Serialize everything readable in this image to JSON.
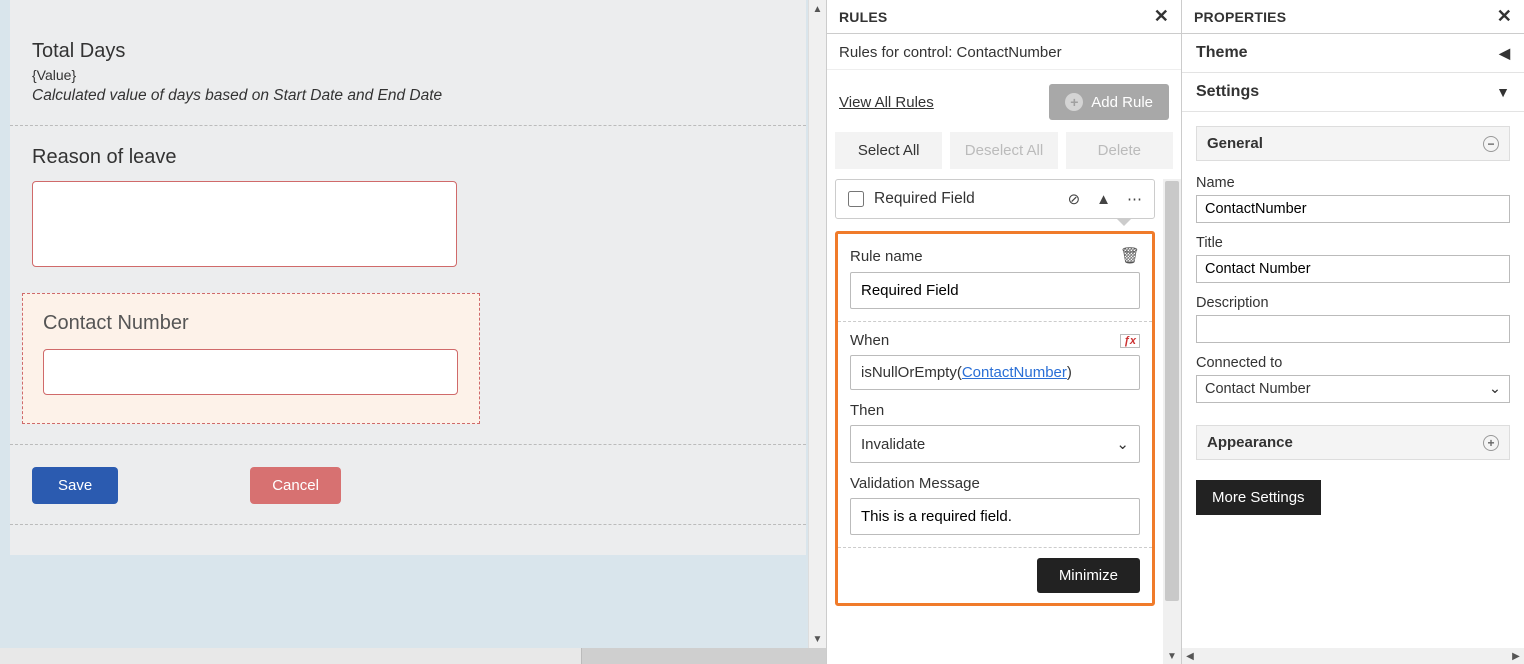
{
  "form": {
    "total_days": {
      "title": "Total Days",
      "value_placeholder": "{Value}",
      "desc": "Calculated value of days based on Start Date and End Date"
    },
    "reason": {
      "title": "Reason of leave"
    },
    "contact": {
      "title": "Contact Number"
    },
    "buttons": {
      "save": "Save",
      "cancel": "Cancel"
    }
  },
  "rules": {
    "header": "RULES",
    "subtitle_prefix": "Rules for control: ",
    "subtitle_control": "ContactNumber",
    "view_all": "View All Rules",
    "add_rule": "Add Rule",
    "select_all": "Select All",
    "deselect_all": "Deselect All",
    "delete": "Delete",
    "rule_row_label": "Required Field",
    "body": {
      "rule_name_label": "Rule name",
      "rule_name_value": "Required Field",
      "when_label": "When",
      "formula_prefix": "isNullOrEmpty(",
      "formula_token": "ContactNumber",
      "formula_suffix": ")",
      "then_label": "Then",
      "then_value": "Invalidate",
      "msg_label": "Validation Message",
      "msg_value": "This is a required field.",
      "minimize": "Minimize"
    }
  },
  "props": {
    "header": "PROPERTIES",
    "theme": "Theme",
    "settings": "Settings",
    "general": "General",
    "name_label": "Name",
    "name_value": "ContactNumber",
    "title_label": "Title",
    "title_value": "Contact Number",
    "desc_label": "Description",
    "desc_value": "",
    "connected_label": "Connected to",
    "connected_value": "Contact Number",
    "appearance": "Appearance",
    "more_settings": "More Settings"
  }
}
